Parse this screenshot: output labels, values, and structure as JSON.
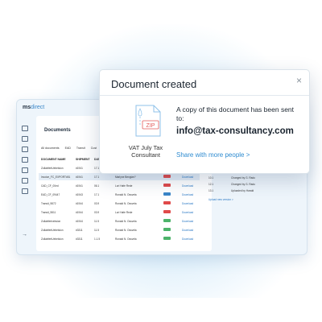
{
  "app": {
    "logo_bold": "ms",
    "logo_light": "direct",
    "documents_title": "Documents",
    "tabs": [
      "All documents",
      "EAD",
      "Transit",
      "Cust"
    ],
    "columns": [
      "DOCUMENT NAME",
      "SHIPMENT",
      "DAT",
      "SENDER/RECEIVER"
    ],
    "rows": [
      {
        "name": "ZollabfertUebelsion",
        "shipment": "#1941",
        "date": "17.1",
        "party": "Ronald N. Ossvela",
        "tag_color": "#e04a4a",
        "download": "Download",
        "alt": false
      },
      {
        "name": "Invoice_FC_EXPORT#51",
        "shipment": "#1941",
        "date": "17.1",
        "party": "Marlyne Bengtze?",
        "tag_color": "#e04a4a",
        "download": "Download",
        "alt": true
      },
      {
        "name": "CAD_CF_00ed",
        "shipment": "#1941",
        "date": "06.1",
        "party": "Lori Hafe Rede",
        "tag_color": "#e04a4a",
        "download": "Download",
        "alt": false
      },
      {
        "name": "EAD_CF_09447",
        "shipment": "#1943",
        "date": "17.1",
        "party": "Ronald N. Ossvela",
        "tag_color": "#3a86c8",
        "download": "Download",
        "alt": false
      },
      {
        "name": "Transit_9872",
        "shipment": "#1944",
        "date": "03.9",
        "party": "Ronald N. Ossvela",
        "tag_color": "#e04a4a",
        "download": "Download",
        "alt": false
      },
      {
        "name": "Transit_9811",
        "shipment": "#1944",
        "date": "03.9",
        "party": "Lori Hafe Rede",
        "tag_color": "#e04a4a",
        "download": "Download",
        "alt": false
      },
      {
        "name": "Zollabfertvebsion",
        "shipment": "#1944",
        "date": "11.5",
        "party": "Ronald N. Ossvela",
        "tag_color": "#4cb36a",
        "download": "Download",
        "alt": false
      },
      {
        "name": "ZollabfertUebelsion",
        "shipment": "#3311",
        "date": "11.5",
        "party": "Ronald N. Ossvela",
        "tag_color": "#4cb36a",
        "download": "Download",
        "alt": false
      },
      {
        "name": "ZollabfertUebelsion",
        "shipment": "#3311",
        "date": "1.1.5",
        "party": "Ronald N. Ossvela",
        "tag_color": "#4cb36a",
        "download": "Download",
        "alt": false
      }
    ],
    "history": [
      {
        "date": "10.1",
        "text": "Changed by G. Radu"
      },
      {
        "date": "12.1",
        "text": "Changed by G. Radu"
      },
      {
        "date": "13.1",
        "text": "Uploaded by Harald"
      }
    ],
    "upload_link": "Upload new version >"
  },
  "modal": {
    "title": "Document created",
    "close_icon": "close-icon",
    "file_type": "ZIP",
    "file_name": "VAT July Tax Consultant",
    "message": "A copy of this document has been sent to:",
    "email": "info@tax-consultancy.com",
    "share_link": "Share with more people >",
    "accent_color": "#2e8bd0"
  }
}
